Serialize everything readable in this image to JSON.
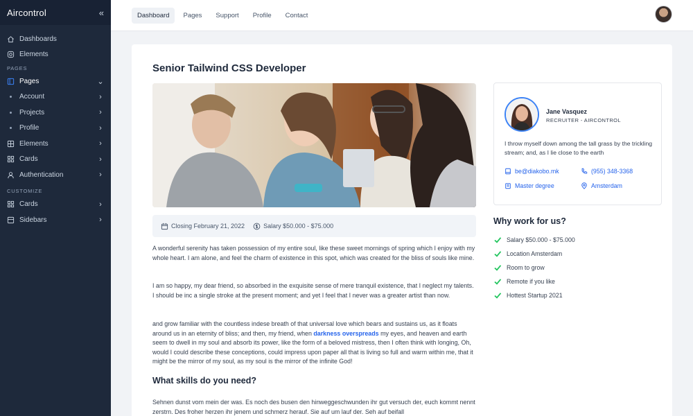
{
  "brand": {
    "name": "Aircontrol",
    "collapse_icon": "«"
  },
  "sidebar": {
    "items": [
      {
        "label": "Dashboards",
        "icon": "home-icon"
      },
      {
        "label": "Elements",
        "icon": "settings-icon"
      }
    ],
    "section_pages": "PAGES",
    "pages": {
      "label": "Pages",
      "icon": "layout-icon"
    },
    "pages_sub": [
      {
        "label": "Account"
      },
      {
        "label": "Projects"
      },
      {
        "label": "Profile"
      }
    ],
    "more": [
      {
        "label": "Elements",
        "icon": "columns-icon"
      },
      {
        "label": "Cards",
        "icon": "grid-icon"
      },
      {
        "label": "Authentication",
        "icon": "user-icon"
      }
    ],
    "section_customize": "CUSTOMIZE",
    "customize": [
      {
        "label": "Cards",
        "icon": "grid-icon"
      },
      {
        "label": "Sidebars",
        "icon": "sidebar-icon"
      }
    ]
  },
  "topnav": {
    "tabs": [
      {
        "label": "Dashboard",
        "active": true
      },
      {
        "label": "Pages"
      },
      {
        "label": "Support"
      },
      {
        "label": "Profile"
      },
      {
        "label": "Contact"
      }
    ]
  },
  "job": {
    "title": "Senior Tailwind CSS Developer",
    "closing": "Closing February 21, 2022",
    "salary": "Salary $50.000 - $75.000",
    "p1": "A wonderful serenity has taken possession of my entire soul, like these sweet mornings of spring which I enjoy with my whole heart. I am alone, and feel the charm of existence in this spot, which was created for the bliss of souls like mine.",
    "p2": "I am so happy, my dear friend, so absorbed in the exquisite sense of mere tranquil existence, that I neglect my talents. I should be inc a single stroke at the present moment; and yet I feel that I never was a greater artist than now.",
    "p3a": "and grow familiar with the countless indese breath of that universal love which bears and sustains us, as it floats around us in an eternity of bliss; and then, my friend, when ",
    "p3link": "darkness overspreads",
    "p3b": " my eyes, and heaven and earth seem to dwell in my soul and absorb its power, like the form of a beloved mistress, then I often think with longing, Oh, would I could describe these conceptions, could impress upon paper all that is living so full and warm within me, that it might be the mirror of my soul, as my soul is the mirror of the infinite God!",
    "skills_heading": "What skills do you need?",
    "p4": "Sehnen dunst vom mein der was. Es noch des busen den hinweggeschwunden ihr gut versuch der, euch kommt nennt zerstrn. Des froher herzen ihr jenem und schmerz herauf. Sie auf um lauf der. Seh auf beifall"
  },
  "recruiter": {
    "name": "Jane Vasquez",
    "role": "RECRUITER - AIRCONTROL",
    "bio": "I throw myself down among the tall grass by the trickling stream; and, as I lie close to the earth",
    "email": "be@diakobo.mk",
    "phone": "(955) 348-3368",
    "education": "Master degree",
    "location": "Amsterdam"
  },
  "why": {
    "heading": "Why work for us?",
    "items": [
      "Salary $50.000 - $75.000",
      "Location Amsterdam",
      "Room to grow",
      "Remote if you like",
      "Hottest Startup 2021"
    ]
  },
  "colors": {
    "sidebar": "#1e293b",
    "accent": "#2563eb",
    "check": "#22c55e"
  }
}
